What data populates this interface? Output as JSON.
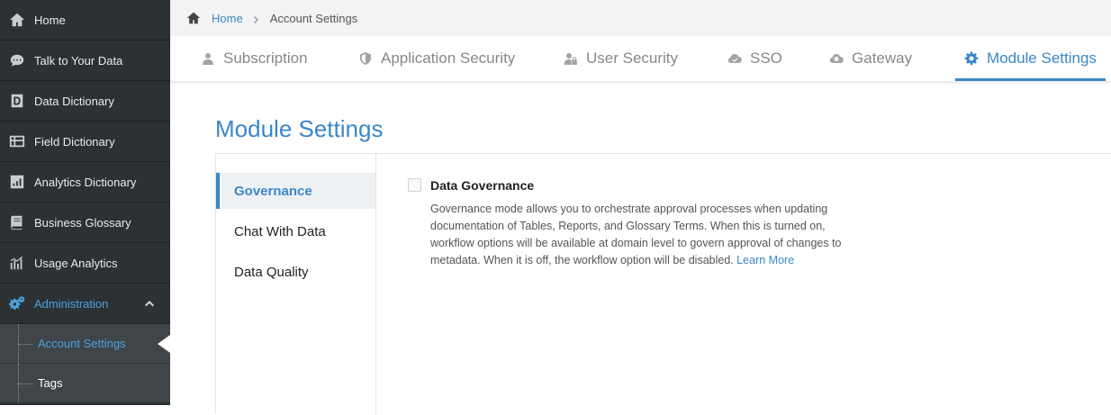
{
  "sidebar": {
    "items": [
      {
        "label": "Home",
        "icon": "home-icon"
      },
      {
        "label": "Talk to Your Data",
        "icon": "chat-icon"
      },
      {
        "label": "Data Dictionary",
        "icon": "data-dictionary-icon"
      },
      {
        "label": "Field Dictionary",
        "icon": "field-dictionary-icon"
      },
      {
        "label": "Analytics Dictionary",
        "icon": "bar-chart-icon"
      },
      {
        "label": "Business Glossary",
        "icon": "book-icon"
      },
      {
        "label": "Usage Analytics",
        "icon": "usage-chart-icon"
      },
      {
        "label": "Administration",
        "icon": "gears-icon",
        "expanded": true
      }
    ],
    "subitems": [
      {
        "label": "Account Settings",
        "active": true
      },
      {
        "label": "Tags",
        "active": false
      }
    ]
  },
  "breadcrumb": {
    "home": "Home",
    "current": "Account Settings"
  },
  "tabs": [
    {
      "label": "Subscription",
      "icon": "user-icon"
    },
    {
      "label": "Application Security",
      "icon": "shield-icon"
    },
    {
      "label": "User Security",
      "icon": "user-lock-icon"
    },
    {
      "label": "SSO",
      "icon": "cloud-icon"
    },
    {
      "label": "Gateway",
      "icon": "cloud-gateway-icon"
    },
    {
      "label": "Module Settings",
      "icon": "gear-icon",
      "active": true
    }
  ],
  "main": {
    "title": "Module Settings",
    "subnav": [
      {
        "label": "Governance",
        "active": true
      },
      {
        "label": "Chat With Data",
        "active": false
      },
      {
        "label": "Data Quality",
        "active": false
      }
    ],
    "setting": {
      "title": "Data Governance",
      "checked": false,
      "description": "Governance mode allows you to orchestrate approval processes when updating documentation of Tables, Reports, and Glossary Terms. When this is turned on, workflow options will be available at domain level to govern approval of changes to metadata. When it is off, the workflow option will be disabled.",
      "link": "Learn More"
    }
  },
  "colors": {
    "accent": "#3a87c8",
    "sidebar_bg": "#2c3133",
    "sidebar_active": "#4da3e0"
  }
}
